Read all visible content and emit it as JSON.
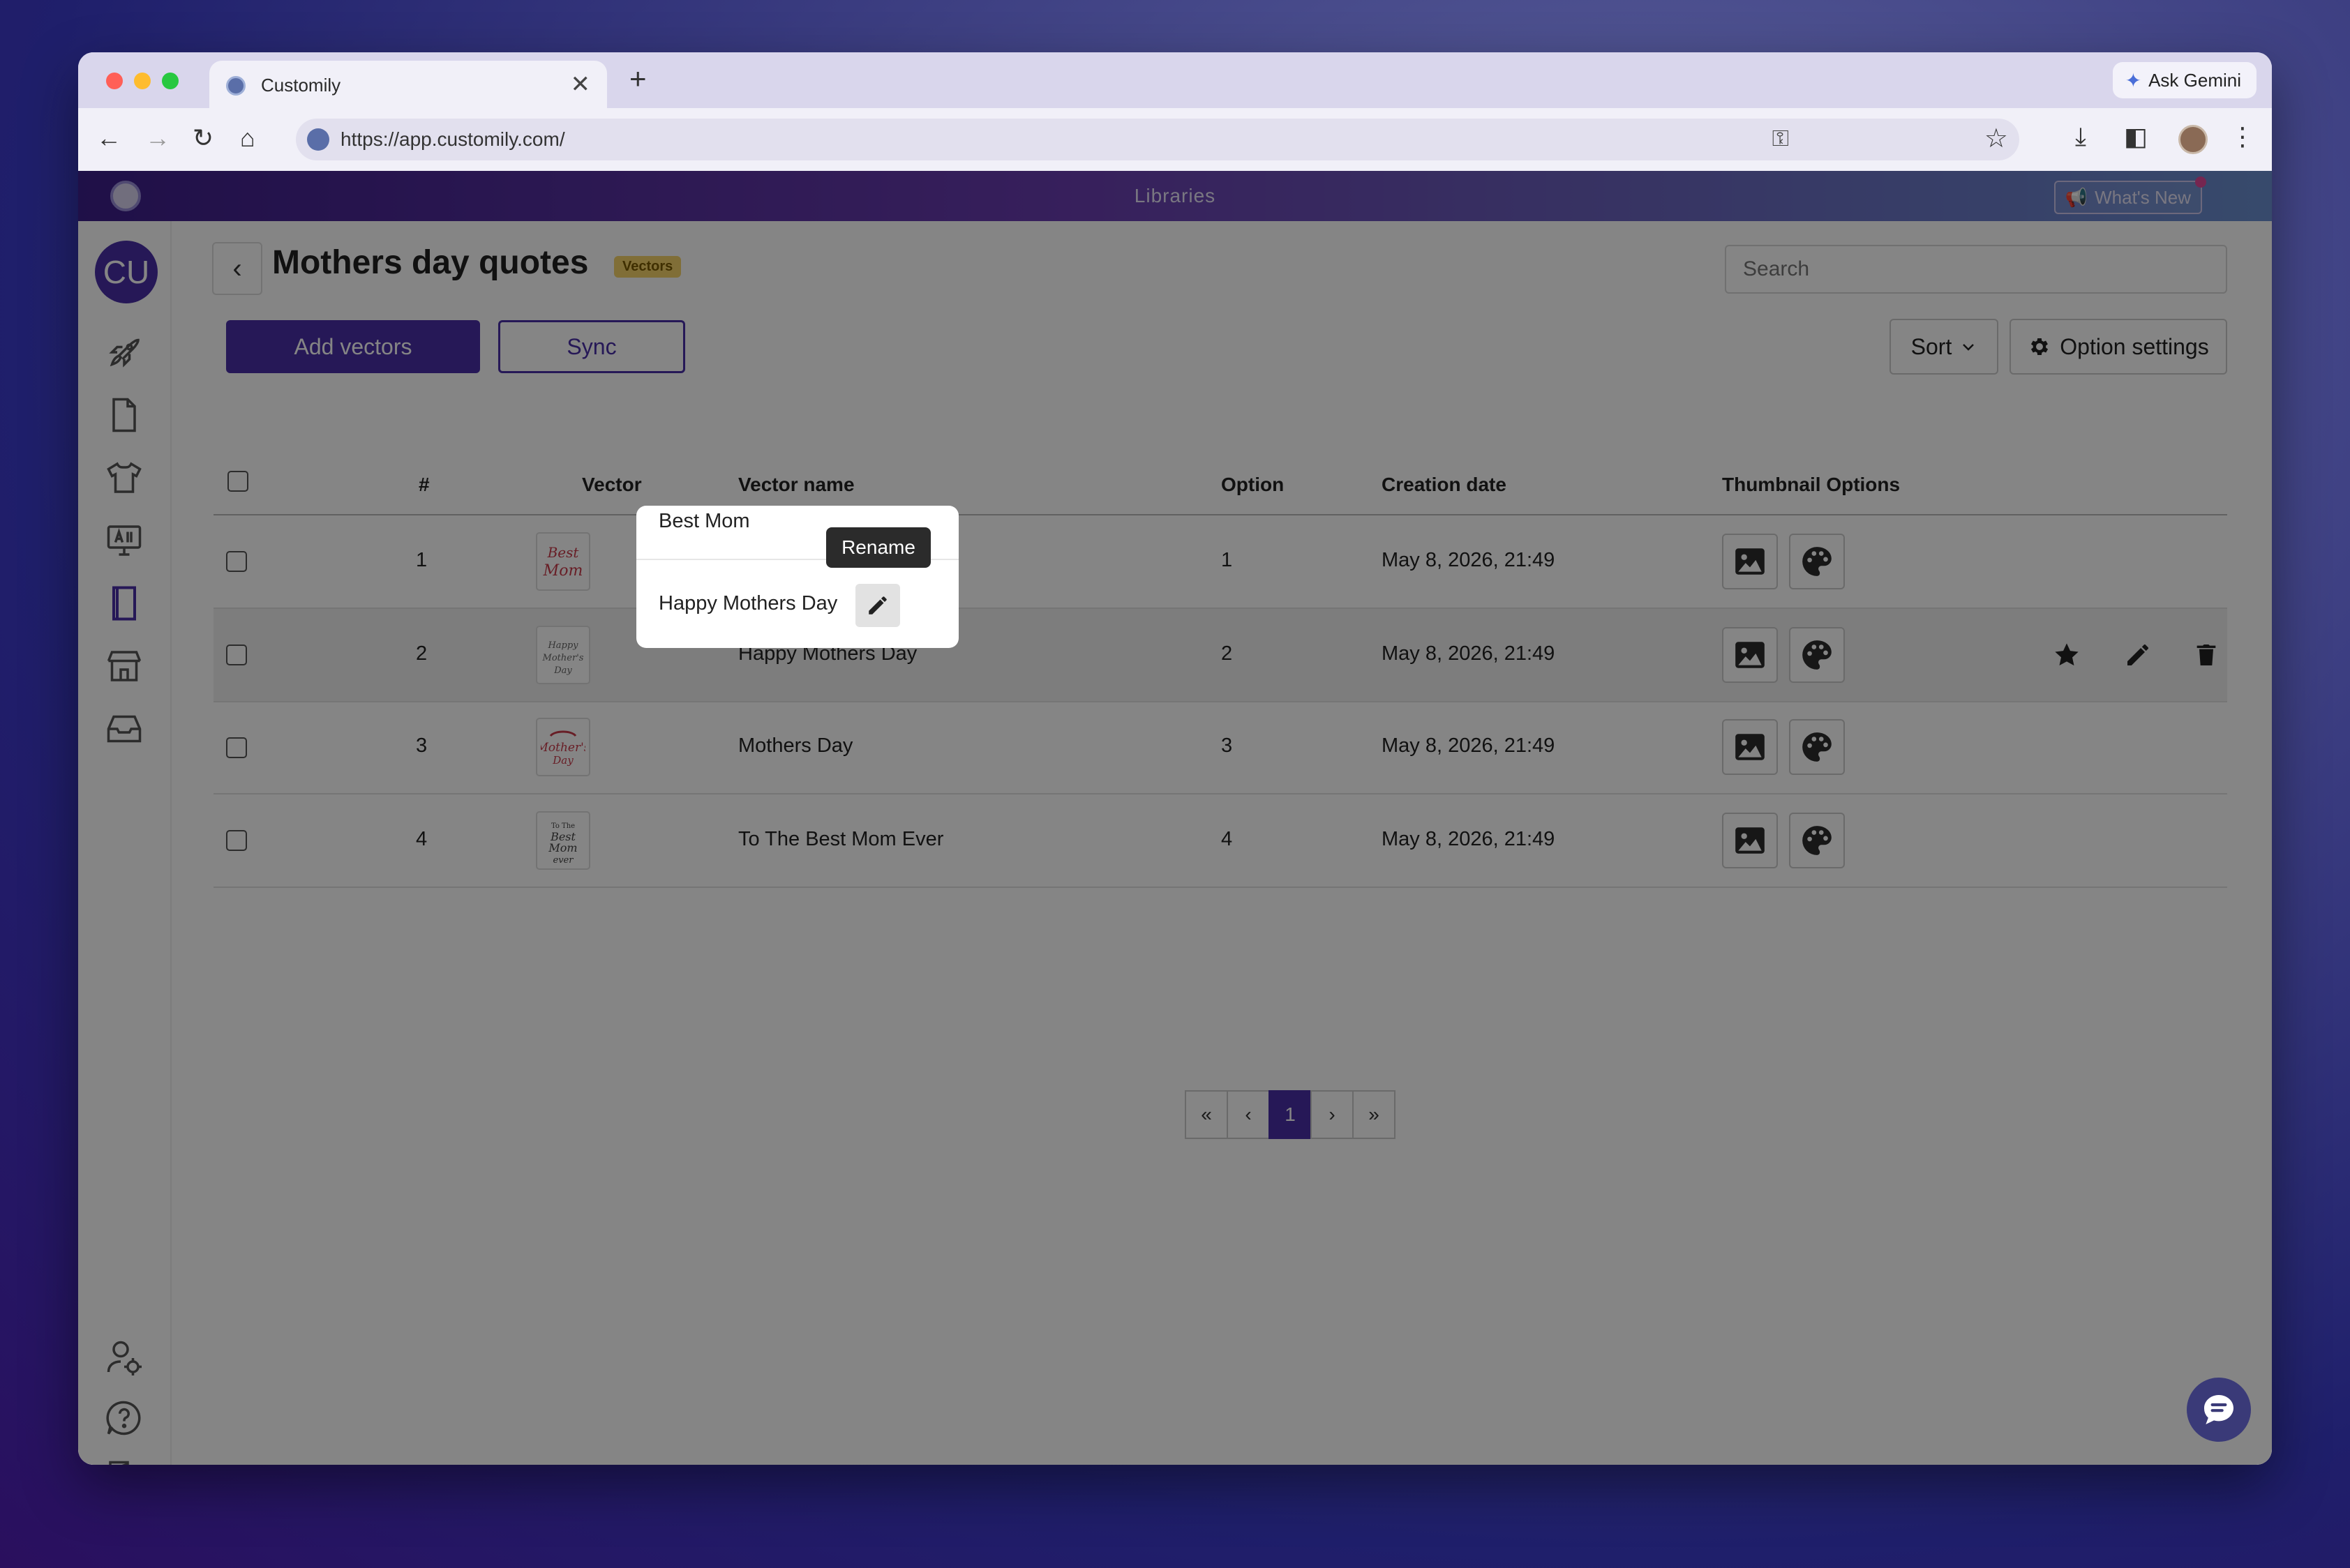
{
  "browser": {
    "tab_title": "Customily",
    "tab_close": "✕",
    "new_tab": "+",
    "url": "https://app.customily.com/",
    "gemini_label": "Ask Gemini",
    "traffic_colors": [
      "#ff5f57",
      "#febc2e",
      "#28c840"
    ]
  },
  "app": {
    "section_title": "Libraries",
    "whats_new": "What's New",
    "avatar_initials": "CU",
    "sidebar_icons": [
      "rocket-icon",
      "document-icon",
      "tshirt-icon",
      "monitor-icon",
      "book-icon",
      "store-icon",
      "inbox-icon",
      "user-settings-icon",
      "help-icon",
      "logout-icon"
    ]
  },
  "library": {
    "name": "Mothers day quotes",
    "badge": "Vectors",
    "search_placeholder": "Search",
    "add_label": "Add vectors",
    "sync_label": "Sync",
    "sort_label": "Sort",
    "option_settings_label": "Option settings"
  },
  "table": {
    "headers": [
      "#",
      "Vector",
      "Vector name",
      "Option",
      "Creation date",
      "Thumbnail Options"
    ],
    "rows": [
      {
        "num": "1",
        "name": "Best Mom",
        "option": "1",
        "date": "May 8, 2026, 21:49"
      },
      {
        "num": "2",
        "name": "Happy Mothers Day",
        "option": "2",
        "date": "May 8, 2026, 21:49"
      },
      {
        "num": "3",
        "name": "Mothers Day",
        "option": "3",
        "date": "May 8, 2026, 21:49"
      },
      {
        "num": "4",
        "name": "To The Best Mom Ever",
        "option": "4",
        "date": "May 8, 2026, 21:49"
      }
    ]
  },
  "pagination": {
    "first": "«",
    "prev": "‹",
    "current": "1",
    "next": "›",
    "last": "»"
  },
  "tooltip": {
    "rename": "Rename"
  }
}
